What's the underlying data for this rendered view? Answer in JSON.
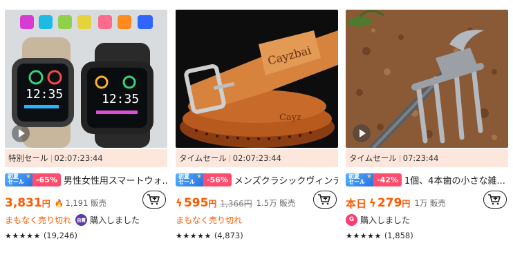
{
  "colors": {
    "accent": "#ff5a00",
    "sale_bar_bg": "#fde7dd",
    "discount_bg": "#ff4d6d",
    "promo_blue": "#2b6fe0"
  },
  "products": [
    {
      "image_icon": "smartwatch-image",
      "sale_label": "特別セール",
      "countdown": "02:07:23:44",
      "promo_tag": "初夏\nセール",
      "discount": "-65%",
      "title": "男性女性用スマートウォ...",
      "price": "3,831",
      "yen": "円",
      "sold": "1,191 販売",
      "urgency": "まもなく売り切れ",
      "avatar_text": "自費",
      "bought": "購入しました",
      "stars": "★★★★★",
      "rating": 4.5,
      "reviews": "(19,246)"
    },
    {
      "image_icon": "leather-belt-image",
      "sale_label": "タイムセール",
      "countdown": "02:07:23:44",
      "promo_tag": "初夏\nセール",
      "discount": "-56%",
      "title": "メンズクラシックヴィンテー...",
      "price": "595",
      "yen": "円",
      "original_price": "1,366円",
      "sold": "1.5万 販売",
      "urgency": "まもなく売り切れ",
      "bought": "",
      "stars": "★★★★★",
      "rating": 4.5,
      "reviews": "(4,873)"
    },
    {
      "image_icon": "garden-rake-image",
      "sale_label": "タイムセール",
      "countdown": "07:23:44",
      "promo_tag": "初夏\nセール",
      "discount": "-42%",
      "title": "1個、4本歯の小さな雑...",
      "price_prefix": "本日",
      "price": "279",
      "yen": "円",
      "sold": "1万 販売",
      "avatar_text": "G",
      "bought": "購入しました",
      "stars": "★★★★★",
      "rating": 4.5,
      "reviews": "(1,858)"
    }
  ]
}
